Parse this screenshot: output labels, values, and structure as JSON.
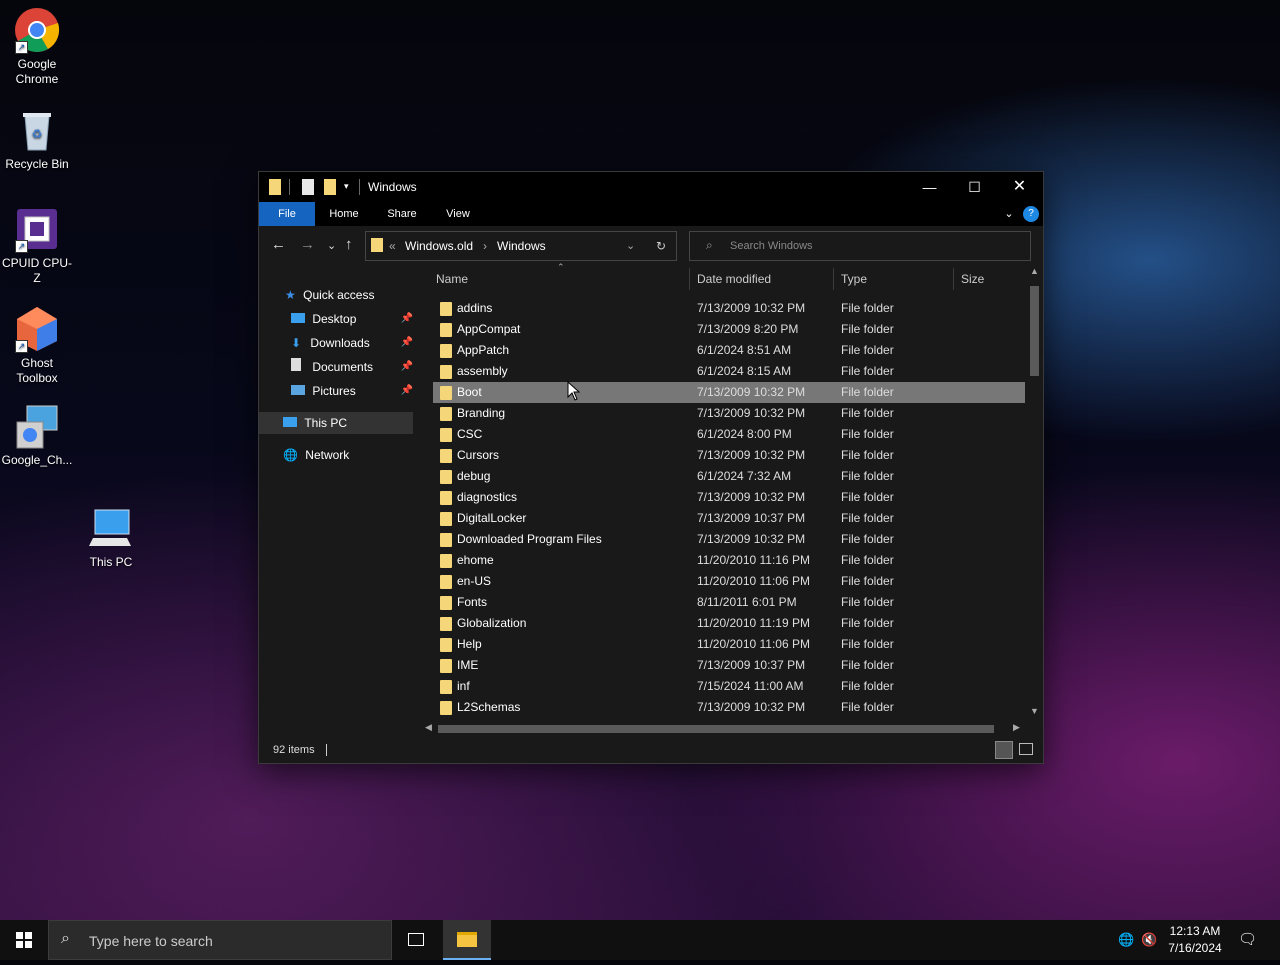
{
  "desktop": {
    "icons": [
      {
        "label": "Google Chrome"
      },
      {
        "label": "Recycle Bin"
      },
      {
        "label": "CPUID CPU-Z"
      },
      {
        "label": "Ghost Toolbox"
      },
      {
        "label": "Google_Ch..."
      },
      {
        "label": "This PC"
      }
    ]
  },
  "window": {
    "title": "Windows",
    "ribbon": {
      "file": "File",
      "home": "Home",
      "share": "Share",
      "view": "View"
    },
    "address": {
      "prefix": "«",
      "segment1": "Windows.old",
      "separator": "›",
      "segment2": "Windows"
    },
    "search_placeholder": "Search Windows",
    "nav": {
      "quick_access": "Quick access",
      "desktop": "Desktop",
      "downloads": "Downloads",
      "documents": "Documents",
      "pictures": "Pictures",
      "this_pc": "This PC",
      "network": "Network"
    },
    "columns": {
      "name": "Name",
      "date": "Date modified",
      "type": "Type",
      "size": "Size"
    },
    "files": [
      {
        "name": "addins",
        "date": "7/13/2009 10:32 PM",
        "type": "File folder"
      },
      {
        "name": "AppCompat",
        "date": "7/13/2009 8:20 PM",
        "type": "File folder"
      },
      {
        "name": "AppPatch",
        "date": "6/1/2024 8:51 AM",
        "type": "File folder"
      },
      {
        "name": "assembly",
        "date": "6/1/2024 8:15 AM",
        "type": "File folder"
      },
      {
        "name": "Boot",
        "date": "7/13/2009 10:32 PM",
        "type": "File folder"
      },
      {
        "name": "Branding",
        "date": "7/13/2009 10:32 PM",
        "type": "File folder"
      },
      {
        "name": "CSC",
        "date": "6/1/2024 8:00 PM",
        "type": "File folder"
      },
      {
        "name": "Cursors",
        "date": "7/13/2009 10:32 PM",
        "type": "File folder"
      },
      {
        "name": "debug",
        "date": "6/1/2024 7:32 AM",
        "type": "File folder"
      },
      {
        "name": "diagnostics",
        "date": "7/13/2009 10:32 PM",
        "type": "File folder"
      },
      {
        "name": "DigitalLocker",
        "date": "7/13/2009 10:37 PM",
        "type": "File folder"
      },
      {
        "name": "Downloaded Program Files",
        "date": "7/13/2009 10:32 PM",
        "type": "File folder"
      },
      {
        "name": "ehome",
        "date": "11/20/2010 11:16 PM",
        "type": "File folder"
      },
      {
        "name": "en-US",
        "date": "11/20/2010 11:06 PM",
        "type": "File folder"
      },
      {
        "name": "Fonts",
        "date": "8/11/2011 6:01 PM",
        "type": "File folder"
      },
      {
        "name": "Globalization",
        "date": "11/20/2010 11:19 PM",
        "type": "File folder"
      },
      {
        "name": "Help",
        "date": "11/20/2010 11:06 PM",
        "type": "File folder"
      },
      {
        "name": "IME",
        "date": "7/13/2009 10:37 PM",
        "type": "File folder"
      },
      {
        "name": "inf",
        "date": "7/15/2024 11:00 AM",
        "type": "File folder"
      },
      {
        "name": "L2Schemas",
        "date": "7/13/2009 10:32 PM",
        "type": "File folder"
      }
    ],
    "status": {
      "count": "92 items"
    }
  },
  "taskbar": {
    "search_placeholder": "Type here to search",
    "time": "12:13 AM",
    "date": "7/16/2024"
  }
}
